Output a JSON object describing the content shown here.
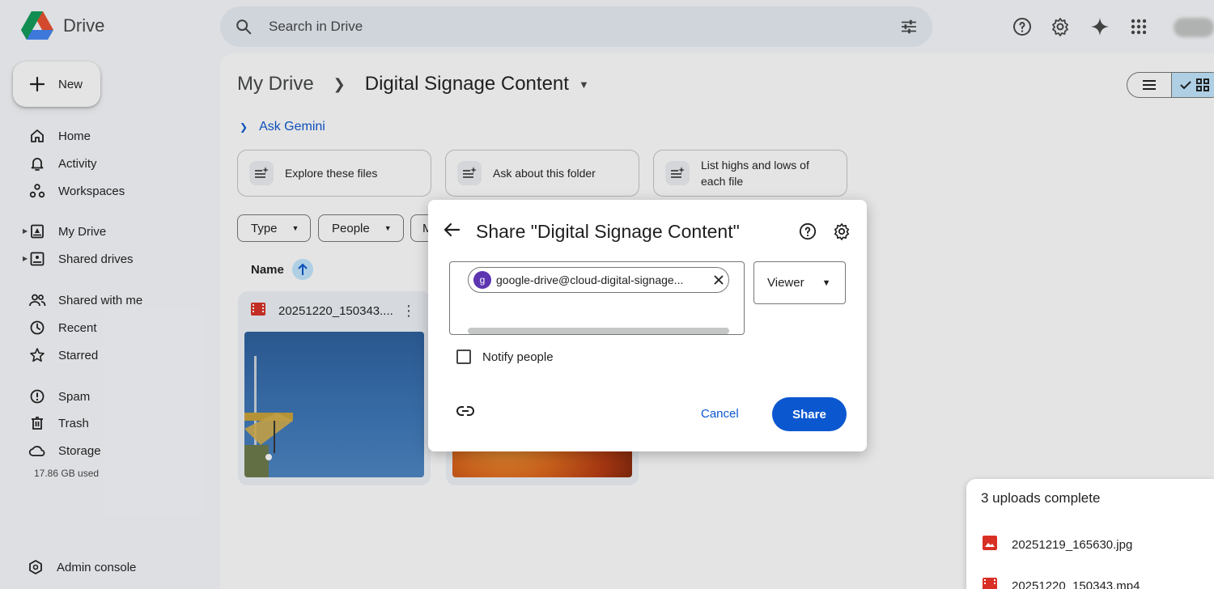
{
  "app": {
    "name": "Drive"
  },
  "search": {
    "placeholder": "Search in Drive"
  },
  "sidebar": {
    "new_label": "New",
    "items": [
      {
        "label": "Home",
        "icon": "home-icon"
      },
      {
        "label": "Activity",
        "icon": "bell-icon"
      },
      {
        "label": "Workspaces",
        "icon": "workspaces-icon"
      },
      {
        "label": "My Drive",
        "icon": "my-drive-icon"
      },
      {
        "label": "Shared drives",
        "icon": "shared-drives-icon"
      },
      {
        "label": "Shared with me",
        "icon": "people-icon"
      },
      {
        "label": "Recent",
        "icon": "clock-icon"
      },
      {
        "label": "Starred",
        "icon": "star-icon"
      },
      {
        "label": "Spam",
        "icon": "spam-icon"
      },
      {
        "label": "Trash",
        "icon": "trash-icon"
      },
      {
        "label": "Storage",
        "icon": "cloud-icon"
      },
      {
        "label": "Admin console",
        "icon": "admin-icon"
      }
    ],
    "storage_used": "17.86 GB used"
  },
  "breadcrumb": {
    "root": "My Drive",
    "current": "Digital Signage Content"
  },
  "gemini": {
    "label": "Ask Gemini",
    "suggestions": [
      "Explore these files",
      "Ask about this folder",
      "List highs and lows of each file"
    ]
  },
  "filters": [
    "Type",
    "People",
    "M"
  ],
  "list": {
    "sort_label": "Name"
  },
  "files": [
    {
      "name": "20251220_150343...."
    }
  ],
  "dialog": {
    "title": "Share \"Digital Signage Content\"",
    "recipient_initial": "g",
    "recipient": "google-drive@cloud-digital-signage...",
    "role": "Viewer",
    "notify_label": "Notify people",
    "cancel_label": "Cancel",
    "share_label": "Share"
  },
  "uploads": {
    "title": "3 uploads complete",
    "items": [
      "20251219_165630.jpg",
      "20251220_150343.mp4"
    ]
  },
  "colors": {
    "accent": "#0b57d0",
    "chip_selected": "#c2e7ff",
    "surface": "#f8fafd"
  }
}
